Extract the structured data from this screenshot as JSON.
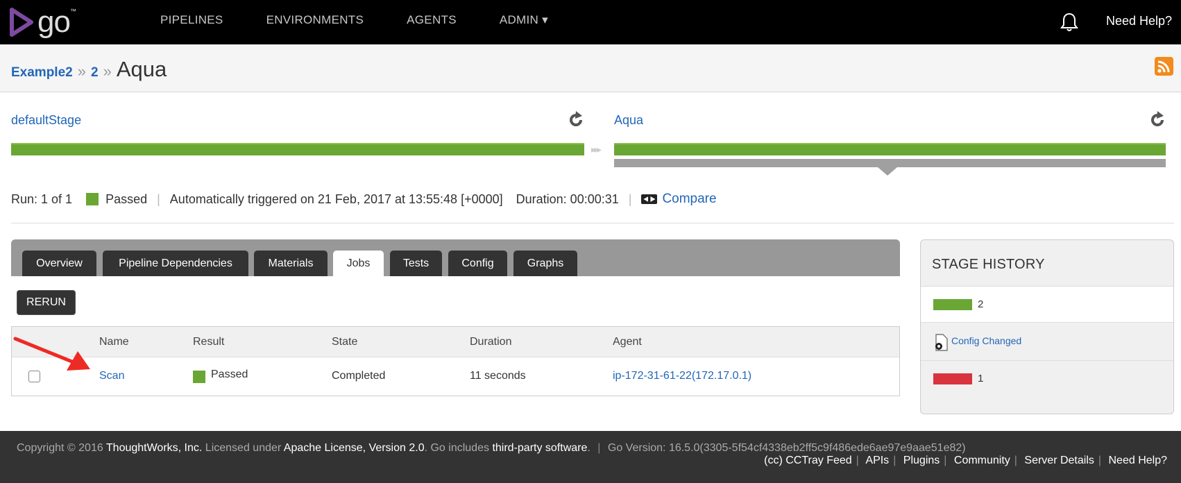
{
  "nav": {
    "logo_text": "go",
    "logo_tm": "™",
    "items": [
      "PIPELINES",
      "ENVIRONMENTS",
      "AGENTS",
      "ADMIN ▾"
    ],
    "help": "Need Help?"
  },
  "breadcrumb": {
    "pipeline": "Example2",
    "counter": "2",
    "stage": "Aqua",
    "separator": "»"
  },
  "stages": [
    {
      "name": "defaultStage",
      "status": "passed"
    },
    {
      "name": "Aqua",
      "status": "passed",
      "selected": true
    }
  ],
  "run": {
    "run_label": "Run: 1 of 1",
    "result": "Passed",
    "triggered": "Automatically triggered on 21 Feb, 2017 at 13:55:48 [+0000]",
    "duration": "Duration: 00:00:31",
    "compare": "Compare",
    "divider": "|"
  },
  "tabs": [
    "Overview",
    "Pipeline Dependencies",
    "Materials",
    "Jobs",
    "Tests",
    "Config",
    "Graphs"
  ],
  "active_tab": "Jobs",
  "rerun_label": "RERUN",
  "jobs": {
    "columns": [
      "Name",
      "Result",
      "State",
      "Duration",
      "Agent"
    ],
    "rows": [
      {
        "name": "Scan",
        "result": "Passed",
        "state": "Completed",
        "duration": "11 seconds",
        "agent": "ip-172-31-61-22(172.17.0.1)"
      }
    ]
  },
  "stage_history": {
    "title": "STAGE HISTORY",
    "entries": [
      {
        "label": "2",
        "status_color": "#6aa634"
      },
      {
        "config_changed": "Config Changed"
      },
      {
        "label": "1",
        "status_color": "#d9333f"
      }
    ]
  },
  "footer": {
    "copyright_prefix": "Copyright © 2016",
    "company": "ThoughtWorks, Inc.",
    "licensed": "Licensed under",
    "license": "Apache License, Version 2.0",
    "includes": ". Go includes",
    "third_party": "third-party software",
    "dot": ".",
    "version": "Go Version: 16.5.0(3305-5f54cf4338eb2ff5c9f486ede6ae97e9aae51e82)",
    "links": [
      "(cc) CCTray Feed",
      "APIs",
      "Plugins",
      "Community",
      "Server Details",
      "Need Help?"
    ]
  },
  "colors": {
    "passed": "#6aa634",
    "failed": "#d9333f",
    "link": "#2166b8"
  }
}
